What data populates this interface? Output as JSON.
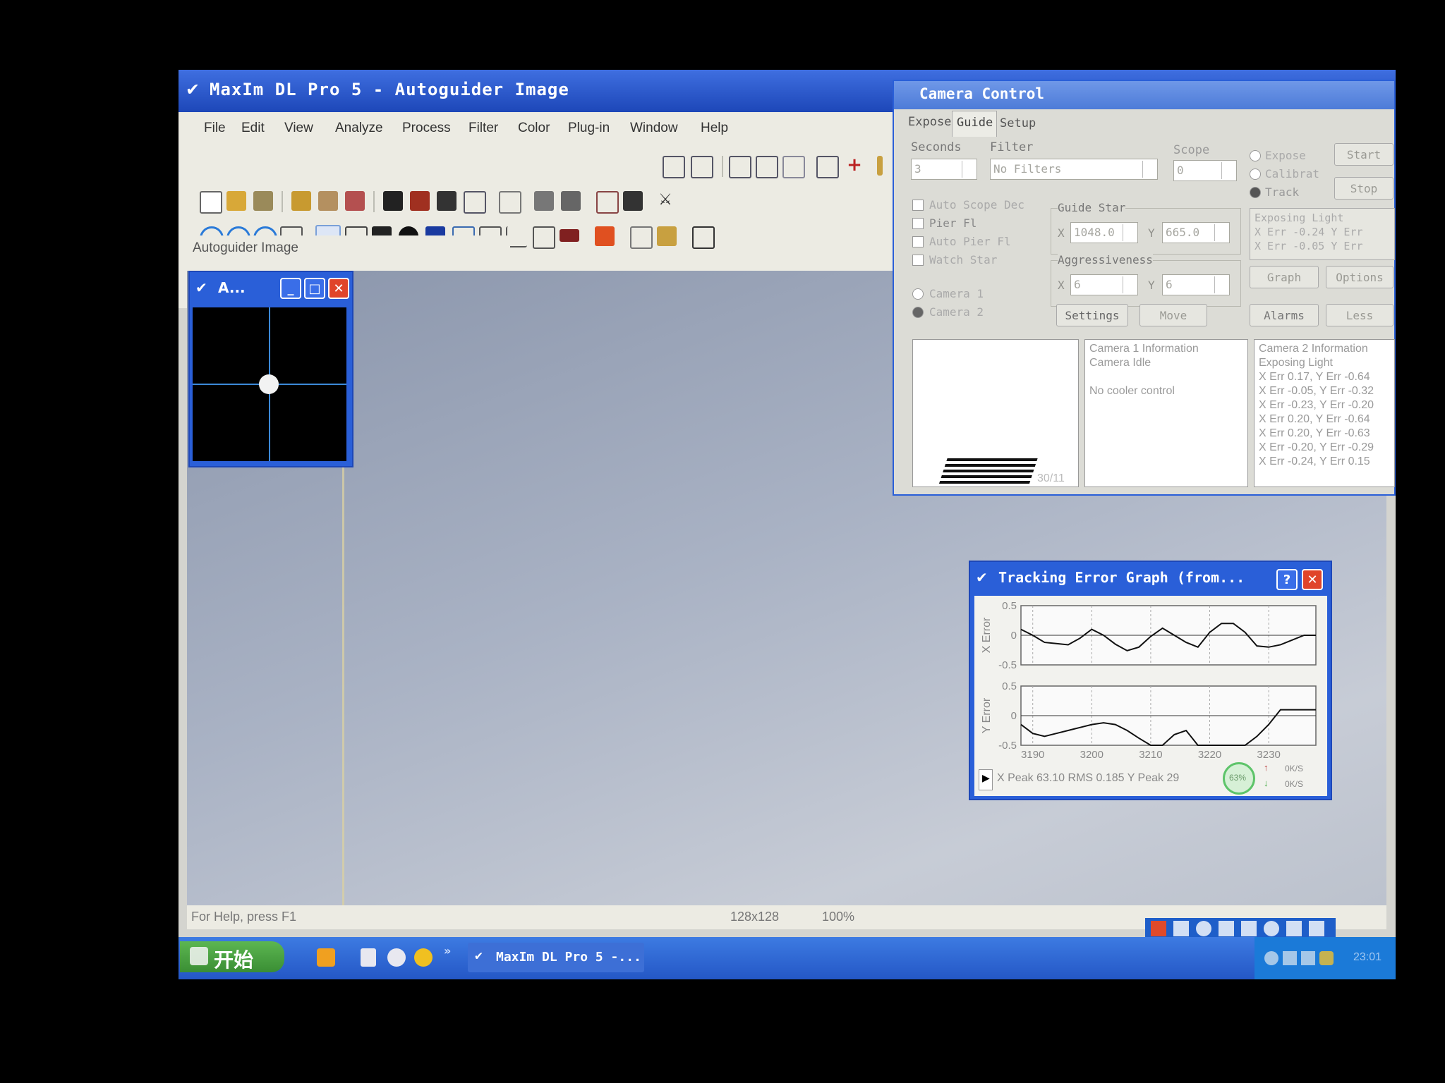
{
  "main": {
    "title": "MaxIm DL Pro 5 - Autoguider Image",
    "menu": [
      "File",
      "Edit",
      "View",
      "Analyze",
      "Process",
      "Filter",
      "Color",
      "Plug-in",
      "Window",
      "Help"
    ],
    "doc_tab": "Autoguider Image",
    "status": {
      "help": "For Help, press F1",
      "size": "128x128",
      "zoom": "100%"
    }
  },
  "image_window": {
    "title": "A..."
  },
  "camera_control": {
    "title": "Camera Control",
    "tabs": [
      "Expose",
      "Guide",
      "Setup"
    ],
    "seconds_label": "Seconds",
    "seconds_value": "3",
    "filter_label": "Filter",
    "filter_value": "No Filters",
    "scope_label": "Scope",
    "scope_value": "0",
    "modes": [
      "Expose",
      "Calibrat",
      "Track"
    ],
    "start_label": "Start",
    "stop_label": "Stop",
    "checks": [
      "Auto Scope Dec",
      "Pier Fl",
      "Auto Pier Fl",
      "Watch Star"
    ],
    "guide_star_label": "Guide Star",
    "guide_x_label": "X",
    "guide_x": "1048.0",
    "guide_y_label": "Y",
    "guide_y": "665.0",
    "aggr_label": "Aggressiveness",
    "aggr_x": "6",
    "aggr_y": "6",
    "cameras": [
      "Camera 1",
      "Camera 2"
    ],
    "settings_label": "Settings",
    "move_label": "Move",
    "graph_label": "Graph",
    "options_label": "Options",
    "alarms_label": "Alarms",
    "less_label": "Less",
    "status_lines": [
      "Exposing Light",
      "X Err  -0.24  Y Err",
      "X Err  -0.05  Y Err"
    ],
    "cam1_info": [
      "Camera 1 Information",
      "Camera Idle",
      "",
      "No cooler control"
    ],
    "cam2_info": [
      "Camera 2 Information",
      "Exposing Light",
      "X Err 0.17, Y Err -0.64",
      "X Err -0.05, Y Err -0.32",
      "X Err -0.23, Y Err -0.20",
      "X Err 0.20, Y Err -0.64",
      "X Err 0.20, Y Err -0.63",
      "X Err -0.20, Y Err -0.29",
      "X Err -0.24, Y Err 0.15"
    ],
    "preview_label": "30/11"
  },
  "tracking_graph": {
    "title": "Tracking Error Graph (from...",
    "footer": "X Peak 63.10 RMS 0.185   Y Peak 29",
    "cpu_badge": "63%",
    "net_up": "0K/S",
    "net_down": "0K/S"
  },
  "chart_data": [
    {
      "type": "line",
      "ylabel": "X Error",
      "ylim": [
        -0.5,
        0.5
      ],
      "yticks": [
        "0.5",
        "0",
        "-0.5"
      ],
      "x": [
        3188,
        3190,
        3192,
        3194,
        3196,
        3198,
        3200,
        3202,
        3204,
        3206,
        3208,
        3210,
        3212,
        3214,
        3216,
        3218,
        3220,
        3222,
        3224,
        3226,
        3228,
        3230,
        3232,
        3234,
        3236,
        3238
      ],
      "series": [
        {
          "values": [
            0.1,
            0.0,
            -0.12,
            -0.14,
            -0.16,
            -0.05,
            0.1,
            0.0,
            -0.15,
            -0.26,
            -0.2,
            -0.02,
            0.12,
            0.0,
            -0.12,
            -0.2,
            0.05,
            0.2,
            0.2,
            0.05,
            -0.18,
            -0.2,
            -0.16,
            -0.08,
            0.0,
            0.0
          ]
        }
      ]
    },
    {
      "type": "line",
      "ylabel": "Y Error",
      "ylim": [
        -0.5,
        0.5
      ],
      "yticks": [
        "0.5",
        "0",
        "-0.5"
      ],
      "xticks": [
        "3190",
        "3200",
        "3210",
        "3220",
        "3230"
      ],
      "x": [
        3188,
        3190,
        3192,
        3194,
        3196,
        3198,
        3200,
        3202,
        3204,
        3206,
        3208,
        3210,
        3212,
        3214,
        3216,
        3218,
        3220,
        3222,
        3224,
        3226,
        3228,
        3230,
        3232,
        3234,
        3236,
        3238
      ],
      "series": [
        {
          "values": [
            -0.15,
            -0.3,
            -0.35,
            -0.3,
            -0.25,
            -0.2,
            -0.15,
            -0.12,
            -0.15,
            -0.25,
            -0.38,
            -0.5,
            -0.5,
            -0.32,
            -0.25,
            -0.5,
            -0.5,
            -0.5,
            -0.5,
            -0.5,
            -0.35,
            -0.15,
            0.1,
            0.1,
            0.1,
            0.1
          ]
        }
      ]
    }
  ],
  "taskbar": {
    "start_label": "开始",
    "task_label": "MaxIm DL Pro 5 -...",
    "clock": "23:01"
  }
}
